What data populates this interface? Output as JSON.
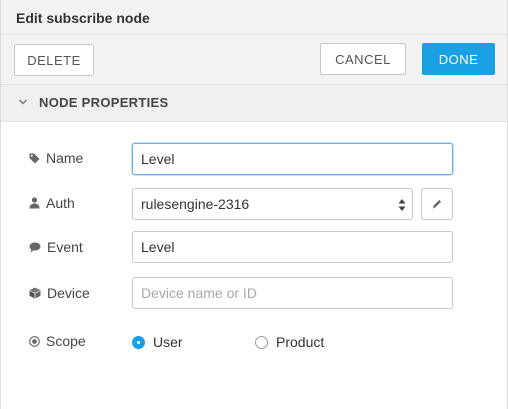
{
  "header": {
    "title": "Edit subscribe node"
  },
  "toolbar": {
    "delete_label": "DELETE",
    "cancel_label": "CANCEL",
    "done_label": "DONE"
  },
  "section": {
    "title": "NODE PROPERTIES"
  },
  "fields": {
    "name": {
      "label": "Name",
      "value": "Level",
      "icon": "tag-icon"
    },
    "auth": {
      "label": "Auth",
      "value": "rulesengine-2316",
      "icon": "user-icon",
      "edit_icon": "pencil-icon"
    },
    "event": {
      "label": "Event",
      "value": "Level",
      "icon": "speech-bubble-icon"
    },
    "device": {
      "label": "Device",
      "placeholder": "Device name or ID",
      "icon": "cube-icon"
    },
    "scope": {
      "label": "Scope",
      "icon": "target-icon",
      "options": [
        "User",
        "Product"
      ],
      "selected": "User"
    }
  },
  "colors": {
    "accent": "#1aa1e4",
    "focus_border": "#6aaee6",
    "header_bg": "#f3f3f3"
  }
}
